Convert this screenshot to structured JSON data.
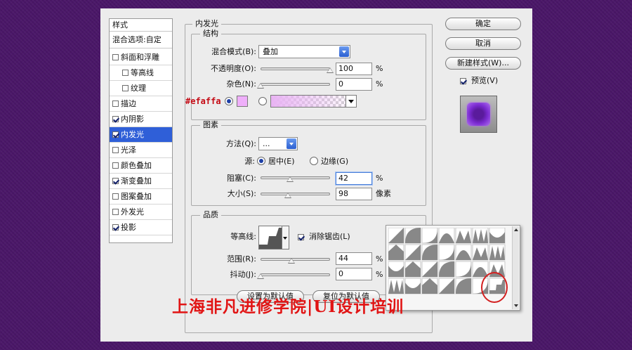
{
  "style_list": {
    "header": "样式",
    "blend_options": "混合选项:自定",
    "items": [
      {
        "label": "斜面和浮雕",
        "checked": false,
        "indent": false,
        "selected": false
      },
      {
        "label": "等高线",
        "checked": false,
        "indent": true,
        "selected": false
      },
      {
        "label": "纹理",
        "checked": false,
        "indent": true,
        "selected": false
      },
      {
        "label": "描边",
        "checked": false,
        "indent": false,
        "selected": false
      },
      {
        "label": "内阴影",
        "checked": true,
        "indent": false,
        "selected": false
      },
      {
        "label": "内发光",
        "checked": true,
        "indent": false,
        "selected": true
      },
      {
        "label": "光泽",
        "checked": false,
        "indent": false,
        "selected": false
      },
      {
        "label": "颜色叠加",
        "checked": false,
        "indent": false,
        "selected": false
      },
      {
        "label": "渐变叠加",
        "checked": true,
        "indent": false,
        "selected": false
      },
      {
        "label": "图案叠加",
        "checked": false,
        "indent": false,
        "selected": false
      },
      {
        "label": "外发光",
        "checked": false,
        "indent": false,
        "selected": false
      },
      {
        "label": "投影",
        "checked": true,
        "indent": false,
        "selected": false
      }
    ]
  },
  "panel": {
    "title": "内发光",
    "structure": {
      "title": "结构",
      "blend_mode_label": "混合模式(B):",
      "blend_mode_value": "叠加",
      "opacity_label": "不透明度(O):",
      "opacity_value": "100",
      "opacity_unit": "%",
      "opacity_level": 1.0,
      "noise_label": "杂色(N):",
      "noise_value": "0",
      "noise_unit": "%",
      "noise_level": 0.0,
      "color_hex_label": "#efaffa",
      "color": "#efaffa"
    },
    "elements": {
      "title": "图素",
      "method_label": "方法(Q):",
      "method_value": "...",
      "source_label": "源:",
      "source_center": "居中(E)",
      "source_edge": "边缘(G)",
      "choke_label": "阻塞(C):",
      "choke_value": "42",
      "choke_unit": "%",
      "choke_level": 0.42,
      "size_label": "大小(S):",
      "size_value": "98",
      "size_unit": "像素",
      "size_level": 0.39
    },
    "quality": {
      "title": "品质",
      "contour_label": "等高线:",
      "anti_alias_label": "消除锯齿(L)",
      "range_label": "范围(R):",
      "range_value": "44",
      "range_unit": "%",
      "range_level": 0.44,
      "jitter_label": "抖动(J):",
      "jitter_value": "0",
      "jitter_unit": "%",
      "jitter_level": 0.0
    },
    "set_default": "设置为默认值",
    "reset_default": "复位为默认值"
  },
  "buttons": {
    "ok": "确定",
    "cancel": "取消",
    "new_style": "新建样式(W)...",
    "preview_label": "预览(V)"
  },
  "watermark": "上海非凡进修学院|UI设计培训"
}
